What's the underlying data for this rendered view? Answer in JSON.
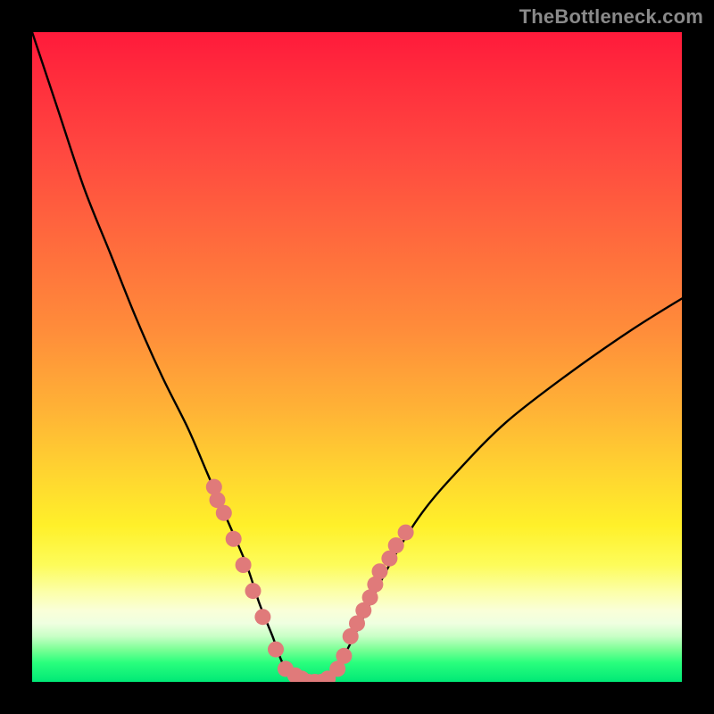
{
  "watermark": "TheBottleneck.com",
  "colors": {
    "frame": "#000000",
    "curve": "#000000",
    "marker": "#e07a7a",
    "gradient_top": "#ff1a3b",
    "gradient_bottom": "#00e876"
  },
  "chart_data": {
    "type": "line",
    "title": "",
    "xlabel": "",
    "ylabel": "",
    "xlim": [
      0,
      100
    ],
    "ylim": [
      0,
      100
    ],
    "grid": false,
    "legend": false,
    "series": [
      {
        "name": "bottleneck-curve",
        "x": [
          0,
          4,
          8,
          12,
          16,
          20,
          24,
          27,
          30,
          33,
          35,
          37,
          38.5,
          40,
          42,
          44,
          46,
          48,
          51,
          55,
          60,
          66,
          73,
          82,
          92,
          100
        ],
        "y": [
          100,
          88,
          76,
          66,
          56,
          47,
          39,
          32,
          25,
          18,
          12,
          7,
          3,
          1,
          0,
          0,
          1,
          4,
          10,
          18,
          26,
          33,
          40,
          47,
          54,
          59
        ]
      }
    ],
    "markers": {
      "name": "highlight-points",
      "points": [
        {
          "x": 28.0,
          "y": 30
        },
        {
          "x": 28.5,
          "y": 28
        },
        {
          "x": 29.5,
          "y": 26
        },
        {
          "x": 31.0,
          "y": 22
        },
        {
          "x": 32.5,
          "y": 18
        },
        {
          "x": 34.0,
          "y": 14
        },
        {
          "x": 35.5,
          "y": 10
        },
        {
          "x": 37.5,
          "y": 5
        },
        {
          "x": 39.0,
          "y": 2
        },
        {
          "x": 40.5,
          "y": 1
        },
        {
          "x": 41.5,
          "y": 0.5
        },
        {
          "x": 42.5,
          "y": 0
        },
        {
          "x": 43.5,
          "y": 0
        },
        {
          "x": 44.5,
          "y": 0
        },
        {
          "x": 45.5,
          "y": 0.5
        },
        {
          "x": 47.0,
          "y": 2
        },
        {
          "x": 48.0,
          "y": 4
        },
        {
          "x": 49.0,
          "y": 7
        },
        {
          "x": 50.0,
          "y": 9
        },
        {
          "x": 51.0,
          "y": 11
        },
        {
          "x": 52.0,
          "y": 13
        },
        {
          "x": 52.8,
          "y": 15
        },
        {
          "x": 53.5,
          "y": 17
        },
        {
          "x": 55.0,
          "y": 19
        },
        {
          "x": 57.5,
          "y": 23
        },
        {
          "x": 56.0,
          "y": 21
        }
      ]
    }
  }
}
